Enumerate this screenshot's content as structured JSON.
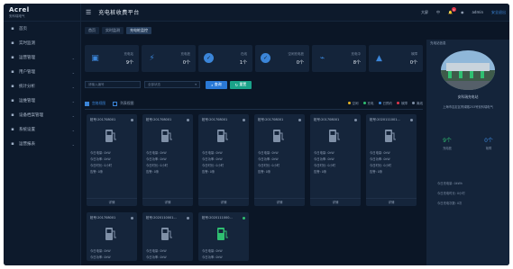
{
  "logo": {
    "brand": "Acrel",
    "sub": "安科瑞电气"
  },
  "sidebar": {
    "items": [
      {
        "label": "首页",
        "icon": "home-icon",
        "chev": false
      },
      {
        "label": "实时监测",
        "icon": "monitor-icon",
        "chev": false
      },
      {
        "label": "运营管理",
        "icon": "operation-icon",
        "chev": true
      },
      {
        "label": "用户管理",
        "icon": "user-icon",
        "chev": true
      },
      {
        "label": "统计分析",
        "icon": "chart-icon",
        "chev": true
      },
      {
        "label": "运维管理",
        "icon": "wrench-icon",
        "chev": true
      },
      {
        "label": "设备档案管理",
        "icon": "device-icon",
        "chev": true
      },
      {
        "label": "系统设置",
        "icon": "settings-icon",
        "chev": true
      },
      {
        "label": "运营报表",
        "icon": "report-icon",
        "chev": true
      }
    ]
  },
  "topbar": {
    "title": "充电桩收费平台",
    "right": [
      "大屏",
      "中",
      "",
      "admin",
      "安全退出"
    ],
    "bell_count": "1"
  },
  "tabs": [
    "首页",
    "实时监测",
    "充电桩监控"
  ],
  "stats": [
    {
      "label": "充电站",
      "value": "9个",
      "icon": "station-icon",
      "glyph": "▣",
      "round": false
    },
    {
      "label": "充电桩",
      "value": "0个",
      "icon": "bolt-icon",
      "glyph": "⚡",
      "round": false
    },
    {
      "label": "在线",
      "value": "1个",
      "icon": "check-circle-icon",
      "glyph": "✓",
      "round": true
    },
    {
      "label": "空闲充电桩",
      "value": "0个",
      "icon": "check-circle-icon",
      "glyph": "✓",
      "round": true
    },
    {
      "label": "充电中",
      "value": "8个",
      "icon": "plug-icon",
      "glyph": "⌁",
      "round": false
    },
    {
      "label": "故障",
      "value": "0个",
      "icon": "warning-icon",
      "glyph": "▲",
      "round": false
    }
  ],
  "filter": {
    "input_placeholder": "请输入编号",
    "select_value": "全部状态",
    "query": "查询",
    "reset": "重置"
  },
  "view": {
    "tabs": [
      "宫格视图",
      "列表视图"
    ],
    "legend": [
      {
        "label": "空闲",
        "color": "#e7b524"
      },
      {
        "label": "充电",
        "color": "#2fbf71"
      },
      {
        "label": "已预约",
        "color": "#3b85d8"
      },
      {
        "label": "故障",
        "color": "#e0374c"
      },
      {
        "label": "离线",
        "color": "#7f90a7"
      }
    ]
  },
  "cards": [
    {
      "title": "桩号:201708001",
      "status_color": "#7f90a7",
      "pile_color": "#7f90a7",
      "rows": [
        "今日电量: 0kW",
        "今日功率: 0kW",
        "今日时长: 0小时",
        "告警: 0条"
      ],
      "foot": "详情"
    },
    {
      "title": "桩号:201708001",
      "status_color": "#7f90a7",
      "pile_color": "#7f90a7",
      "rows": [
        "今日电量: 0kW",
        "今日功率: 0kW",
        "今日时长: 0小时",
        "告警: 0条"
      ],
      "foot": "详情"
    },
    {
      "title": "桩号:201708001",
      "status_color": "#7f90a7",
      "pile_color": "#7f90a7",
      "rows": [
        "今日电量: 0kW",
        "今日功率: 0kW",
        "今日时长: 0小时",
        "告警: 0条"
      ],
      "foot": "详情"
    },
    {
      "title": "桩号:201708001",
      "status_color": "#7f90a7",
      "pile_color": "#7f90a7",
      "rows": [
        "今日电量: 0kW",
        "今日功率: 0kW",
        "今日时长: 0小时",
        "告警: 0条"
      ],
      "foot": "详情"
    },
    {
      "title": "桩号:201708001",
      "status_color": "#7f90a7",
      "pile_color": "#7f90a7",
      "rows": [
        "今日电量: 0kW",
        "今日功率: 0kW",
        "今日时长: 0小时",
        "告警: 0条"
      ],
      "foot": "详情"
    },
    {
      "title": "桩号:2020111001...",
      "status_color": "#7f90a7",
      "pile_color": "#7f90a7",
      "rows": [
        "今日电量: 0kW",
        "今日功率: 0kW",
        "今日时长: 0小时",
        "告警: 0条"
      ],
      "foot": "详情"
    },
    {
      "title": "桩号:201708001",
      "status_color": "#7f90a7",
      "pile_color": "#7f90a7",
      "rows": [
        "今日电量: 0kW",
        "今日功率: 0kW"
      ],
      "foot": ""
    },
    {
      "title": "桩号:2020110001...",
      "status_color": "#7f90a7",
      "pile_color": "#7f90a7",
      "rows": [
        "今日电量: 0kW",
        "今日功率: 0kW"
      ],
      "foot": ""
    },
    {
      "title": "桩号:2020111000...",
      "status_color": "#2fbf71",
      "pile_color": "#2fbf71",
      "rows": [
        "今日电量: 0kW",
        "今日功率: 0kW"
      ],
      "foot": ""
    }
  ],
  "right_panel": {
    "header": "充电站信息",
    "name": "安科瑞充电站",
    "address": "上海市嘉定区育绿路253号安科瑞电气",
    "nums": [
      {
        "n": "9个",
        "l": "充电桩"
      },
      {
        "n": "0个",
        "l": "故障"
      }
    ],
    "info": [
      "今日充电量: 0kWh",
      "今日充电时长: 0小时",
      "今日充电次数: 0次"
    ]
  }
}
